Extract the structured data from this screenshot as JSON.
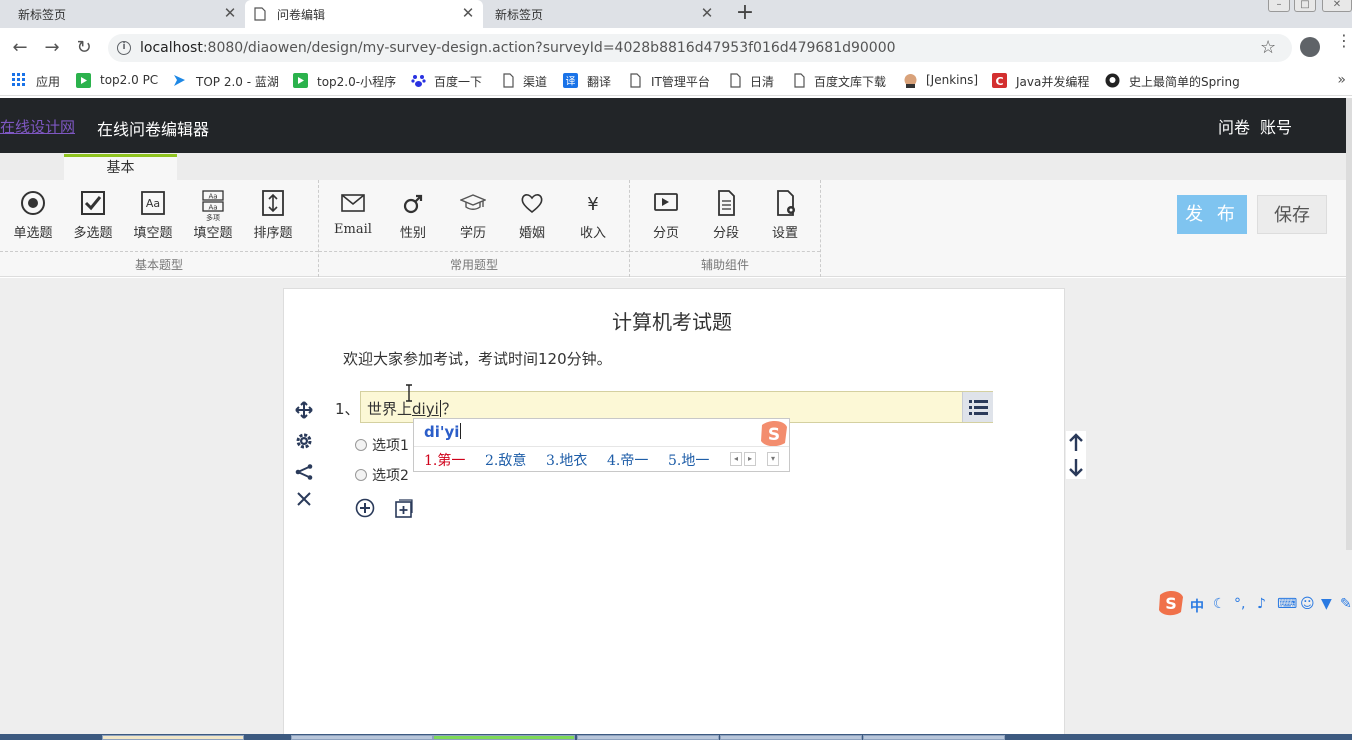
{
  "browser": {
    "tabs": [
      {
        "title": "新标签页",
        "active": false
      },
      {
        "title": "问卷编辑",
        "active": true
      },
      {
        "title": "新标签页",
        "active": false
      }
    ],
    "url_host": "localhost",
    "url_rest": ":8080/diaowen/design/my-survey-design.action?surveyId=4028b8816d47953f016d479681d90000",
    "bookmarks": [
      "应用",
      "top2.0 PC",
      "TOP 2.0 - 蓝湖",
      "top2.0-小程序",
      "百度一下",
      "渠道",
      "翻译",
      "IT管理平台",
      "日清",
      "百度文库下载",
      "[Jenkins]",
      "Java并发编程",
      "史上最简单的Spring"
    ]
  },
  "app": {
    "logo": "在线设计网",
    "title": "在线问卷编辑器",
    "nav": {
      "survey": "问卷",
      "account": "账号"
    }
  },
  "ribbon": {
    "tab": "基本",
    "groups": [
      {
        "label": "基本题型",
        "tools": [
          "单选题",
          "多选题",
          "填空题",
          "填空题",
          "排序题"
        ]
      },
      {
        "label": "常用题型",
        "tools": [
          "Email",
          "性别",
          "学历",
          "婚姻",
          "收入"
        ]
      },
      {
        "label": "辅助组件",
        "tools": [
          "分页",
          "分段",
          "设置"
        ]
      }
    ],
    "multi_badge": "多项",
    "publish": "发 布",
    "save": "保存"
  },
  "survey": {
    "title": "计算机考试题",
    "description": "欢迎大家参加考试，考试时间120分钟。",
    "question": {
      "number": "1、",
      "text_before": "世界上",
      "composing": "diyi",
      "text_after": "？",
      "options": [
        "选项1",
        "选项2"
      ]
    }
  },
  "ime": {
    "composition": "di'yi",
    "candidates": [
      "1.第一",
      "2.敌意",
      "3.地衣",
      "4.帝一",
      "5.地一"
    ],
    "toolbar_char": "中"
  },
  "colors": {
    "header_bg": "#222528",
    "ribbon_accent": "#8fc31f",
    "publish_bg": "#7fc4f0",
    "question_bg": "#fcf8d6",
    "ime_selected": "#d0021b",
    "ime_candidate": "#1f5ea8"
  }
}
